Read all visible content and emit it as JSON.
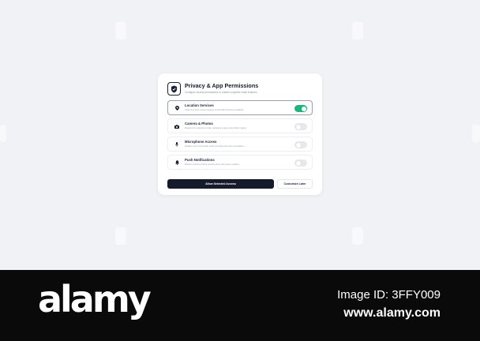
{
  "dialog": {
    "title": "Privacy & App Permissions",
    "subtitle": "Configure access permissions to enable complete smart features",
    "permissions": [
      {
        "name": "Location Services",
        "description": "Used for precise speed mapping and localized feature availability",
        "enabled": true,
        "icon": "location-pin-icon"
      },
      {
        "name": "Camera & Photos",
        "description": "Required for capturing media, uploading images and profile imaging",
        "enabled": false,
        "icon": "camera-icon"
      },
      {
        "name": "Microphone Access",
        "description": "Enables voice commands, audio recording and noise cancellation",
        "enabled": false,
        "icon": "microphone-icon"
      },
      {
        "name": "Push Notifications",
        "description": "Delivers real-time critical security alerts and system updates",
        "enabled": false,
        "icon": "bell-icon"
      }
    ],
    "primary_button": "Allow Selected Access",
    "secondary_button": "Customize Later"
  },
  "colors": {
    "toggle_on": "#1cb67c",
    "primary_button": "#151b2b",
    "page_background": "#f1f2f5"
  },
  "watermark": {
    "brand": "alamy",
    "image_id": "Image ID: 3FFY009",
    "site": "www.alamy.com"
  }
}
